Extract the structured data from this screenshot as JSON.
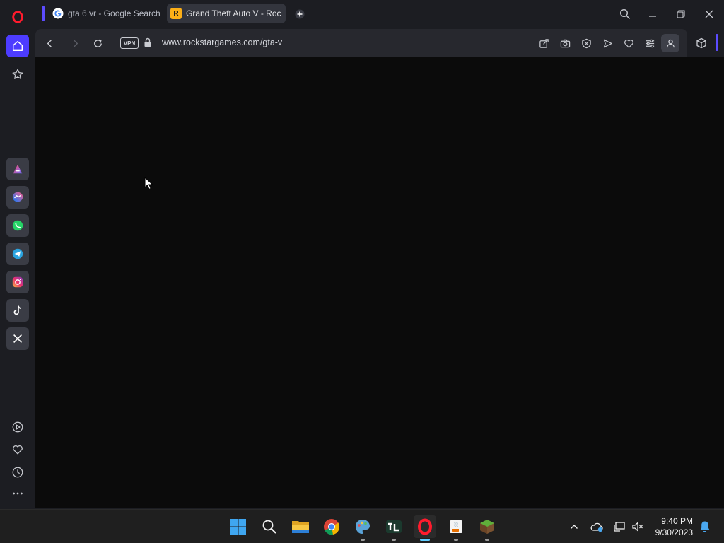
{
  "browser": {
    "tabs": [
      {
        "label": "gta 6 vr - Google Search",
        "favicon": "google-g-icon",
        "active": false
      },
      {
        "label": "Grand Theft Auto V - Roc",
        "favicon": "rockstar-icon",
        "favicon_text": "R",
        "active": true
      }
    ],
    "url": "www.rockstargames.com/gta-v",
    "vpn_label": "VPN"
  },
  "sidebar": {
    "items": [
      "opera-logo-icon",
      "home-icon",
      "star-icon",
      "aria-icon",
      "messenger-icon",
      "whatsapp-icon",
      "telegram-icon",
      "instagram-icon",
      "tiktok-icon",
      "x-icon",
      "player-icon",
      "heart-icon",
      "history-icon",
      "more-icon"
    ]
  },
  "taskbar": {
    "time": "9:40 PM",
    "date": "9/30/2023"
  },
  "colors": {
    "accent": "#5c4cff",
    "content_bg": "#0b0b0b",
    "chrome_bg": "#1c1d22",
    "taskbar_bg": "#1f1f1f"
  }
}
